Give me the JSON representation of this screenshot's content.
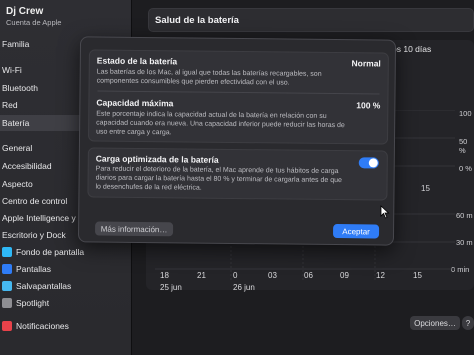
{
  "sidebar": {
    "profile_name": "Dj Crew",
    "profile_sub": "Cuenta de Apple",
    "items": [
      {
        "label": "Familia",
        "color": "#6a6a70"
      },
      {
        "label": "Wi-Fi",
        "color": "#2f7cf6"
      },
      {
        "label": "Bluetooth",
        "color": "#2f7cf6"
      },
      {
        "label": "Red",
        "color": "#2f7cf6"
      },
      {
        "label": "Batería",
        "color": "#34c759"
      },
      {
        "label": "General",
        "color": "#8e8e93"
      },
      {
        "label": "Accesibilidad",
        "color": "#2f7cf6"
      },
      {
        "label": "Aspecto",
        "color": "#1c1c1e"
      },
      {
        "label": "Centro de control",
        "color": "#8e8e93"
      },
      {
        "label": "Apple Intelligence y Siri",
        "color": "#d05ad8"
      },
      {
        "label": "Escritorio y Dock",
        "color": "#1c1c1e"
      },
      {
        "label": "Fondo de pantalla",
        "color": "#2fb8f6"
      },
      {
        "label": "Pantallas",
        "color": "#2f7cf6"
      },
      {
        "label": "Salvapantallas",
        "color": "#46b8f0"
      },
      {
        "label": "Spotlight",
        "color": "#8e8e93"
      },
      {
        "label": "Notificaciones",
        "color": "#e8424a"
      }
    ]
  },
  "header": {
    "title": "Salud de la batería"
  },
  "background": {
    "segment_label": "os 10 días",
    "right_labels": [
      "100",
      "50 %",
      "0 %",
      "60 m",
      "30 m",
      "0 min"
    ],
    "x_ticks": [
      "18",
      "21",
      "0",
      "03",
      "06",
      "09",
      "12",
      "15"
    ],
    "x_dates": [
      "25 jun",
      "26 jun"
    ],
    "partial_tick": "15",
    "options_label": "Opciones…",
    "help_label": "?"
  },
  "modal": {
    "state_title": "Estado de la batería",
    "state_value": "Normal",
    "state_desc": "Las baterías de los Mac, al igual que todas las baterías recargables, son componentes consumibles que pierden efectividad con el uso.",
    "capacity_title": "Capacidad máxima",
    "capacity_value": "100 %",
    "capacity_desc": "Este porcentaje indica la capacidad actual de la batería en relación con su capacidad cuando era nueva. Una capacidad inferior puede reducir las horas de uso entre carga y carga.",
    "optimized_title": "Carga optimizada de la batería",
    "optimized_desc": "Para reducir el deterioro de la batería, el Mac aprende de tus hábitos de carga diarios para cargar la batería hasta el 80 % y terminar de cargarla antes de que lo desenchufes de la red eléctrica.",
    "more_info": "Más información…",
    "accept": "Aceptar"
  },
  "colors": {
    "accent": "#2f7cf6"
  }
}
